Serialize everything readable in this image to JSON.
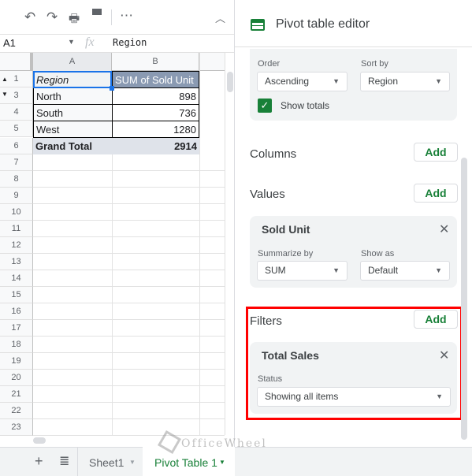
{
  "toolbar": {
    "icons": [
      "undo-icon",
      "redo-icon",
      "print-icon",
      "paint-format-icon",
      "more-icon",
      "collapse-icon"
    ],
    "more": "⋯"
  },
  "formula_bar": {
    "cell_ref": "A1",
    "fx": "fx",
    "value": "Region"
  },
  "sheet": {
    "columns": [
      "A",
      "B"
    ],
    "rows": [
      {
        "num": "1",
        "a": "Region",
        "b": "SUM of Sold Unit"
      },
      {
        "num": "3",
        "a": "North",
        "b": "898"
      },
      {
        "num": "4",
        "a": "South",
        "b": "736"
      },
      {
        "num": "5",
        "a": "West",
        "b": "1280"
      },
      {
        "num": "6",
        "a": "Grand Total",
        "b": "2914"
      }
    ],
    "empty_rows": [
      "7",
      "8",
      "9",
      "10",
      "11",
      "12",
      "13",
      "14",
      "15",
      "16",
      "17",
      "18",
      "19",
      "20",
      "21",
      "22",
      "23"
    ]
  },
  "panel": {
    "title": "Pivot table editor",
    "rows_card": {
      "order_label": "Order",
      "order_value": "Ascending",
      "sortby_label": "Sort by",
      "sortby_value": "Region",
      "show_totals": "Show totals",
      "show_totals_checked": true
    },
    "columns_label": "Columns",
    "values_label": "Values",
    "filters_label": "Filters",
    "add_label": "Add",
    "value_card": {
      "title": "Sold Unit",
      "summarize_label": "Summarize by",
      "summarize_value": "SUM",
      "showas_label": "Show as",
      "showas_value": "Default"
    },
    "filter_card": {
      "title": "Total Sales",
      "status_label": "Status",
      "status_value": "Showing all items"
    },
    "highlight_color": "#ff0000"
  },
  "tabs": [
    {
      "label": "Sheet1",
      "active": false
    },
    {
      "label": "Pivot Table 1",
      "active": true
    }
  ],
  "watermark": "OfficeWheel"
}
